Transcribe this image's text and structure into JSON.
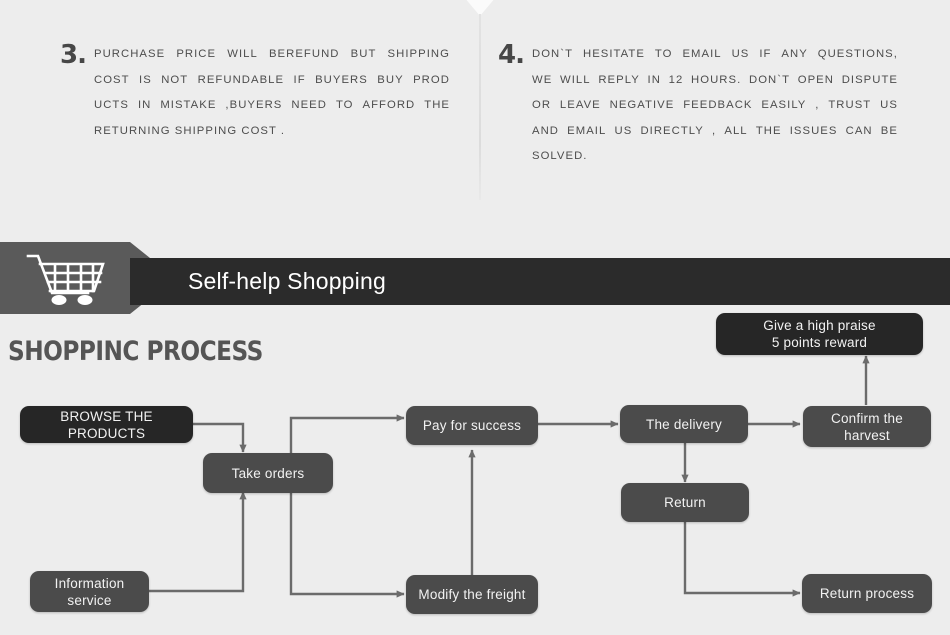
{
  "policies": [
    {
      "number": "3.",
      "lines": [
        "PURCHASE PRICE WILL BEREFUND BUT SHIPPING",
        "COST IS NOT REFUNDABLE IF BUYERS BUY PROD",
        "UCTS IN MISTAKE ,BUYERS NEED TO AFFORD THE",
        " RETURNING SHIPPING COST ."
      ]
    },
    {
      "number": "4.",
      "lines": [
        "DON`T HESITATE TO EMAIL US IF ANY QUESTIONS,",
        "WE WILL REPLY IN 12 HOURS. DON`T OPEN DISPUTE",
        "OR LEAVE NEGATIVE FEEDBACK EASILY , TRUST US",
        "AND EMAIL US DIRECTLY , ALL THE ISSUES CAN BE",
        "SOLVED."
      ]
    }
  ],
  "banner": {
    "title": "Self-help Shopping",
    "icon": "shopping-cart-icon",
    "arrow_color": "#5a5a5a",
    "bar_color": "#2b2b2b"
  },
  "process": {
    "heading": "SHOPPINC PROCESS",
    "node_color": "#4b4b4b",
    "node_dark_color": "#262626",
    "connector_color": "#6b6b6b",
    "nodes": [
      {
        "id": "browse",
        "label": "BROWSE THE PRODUCTS"
      },
      {
        "id": "take-orders",
        "label": "Take orders"
      },
      {
        "id": "info-service",
        "label": "Information\nservice"
      },
      {
        "id": "pay-success",
        "label": "Pay for success"
      },
      {
        "id": "modify-freight",
        "label": "Modify the freight"
      },
      {
        "id": "delivery",
        "label": "The delivery"
      },
      {
        "id": "return",
        "label": "Return"
      },
      {
        "id": "return-process",
        "label": "Return process"
      },
      {
        "id": "confirm",
        "label": "Confirm the\nharvest"
      },
      {
        "id": "praise",
        "label": "Give a high praise\n5 points reward"
      }
    ]
  }
}
